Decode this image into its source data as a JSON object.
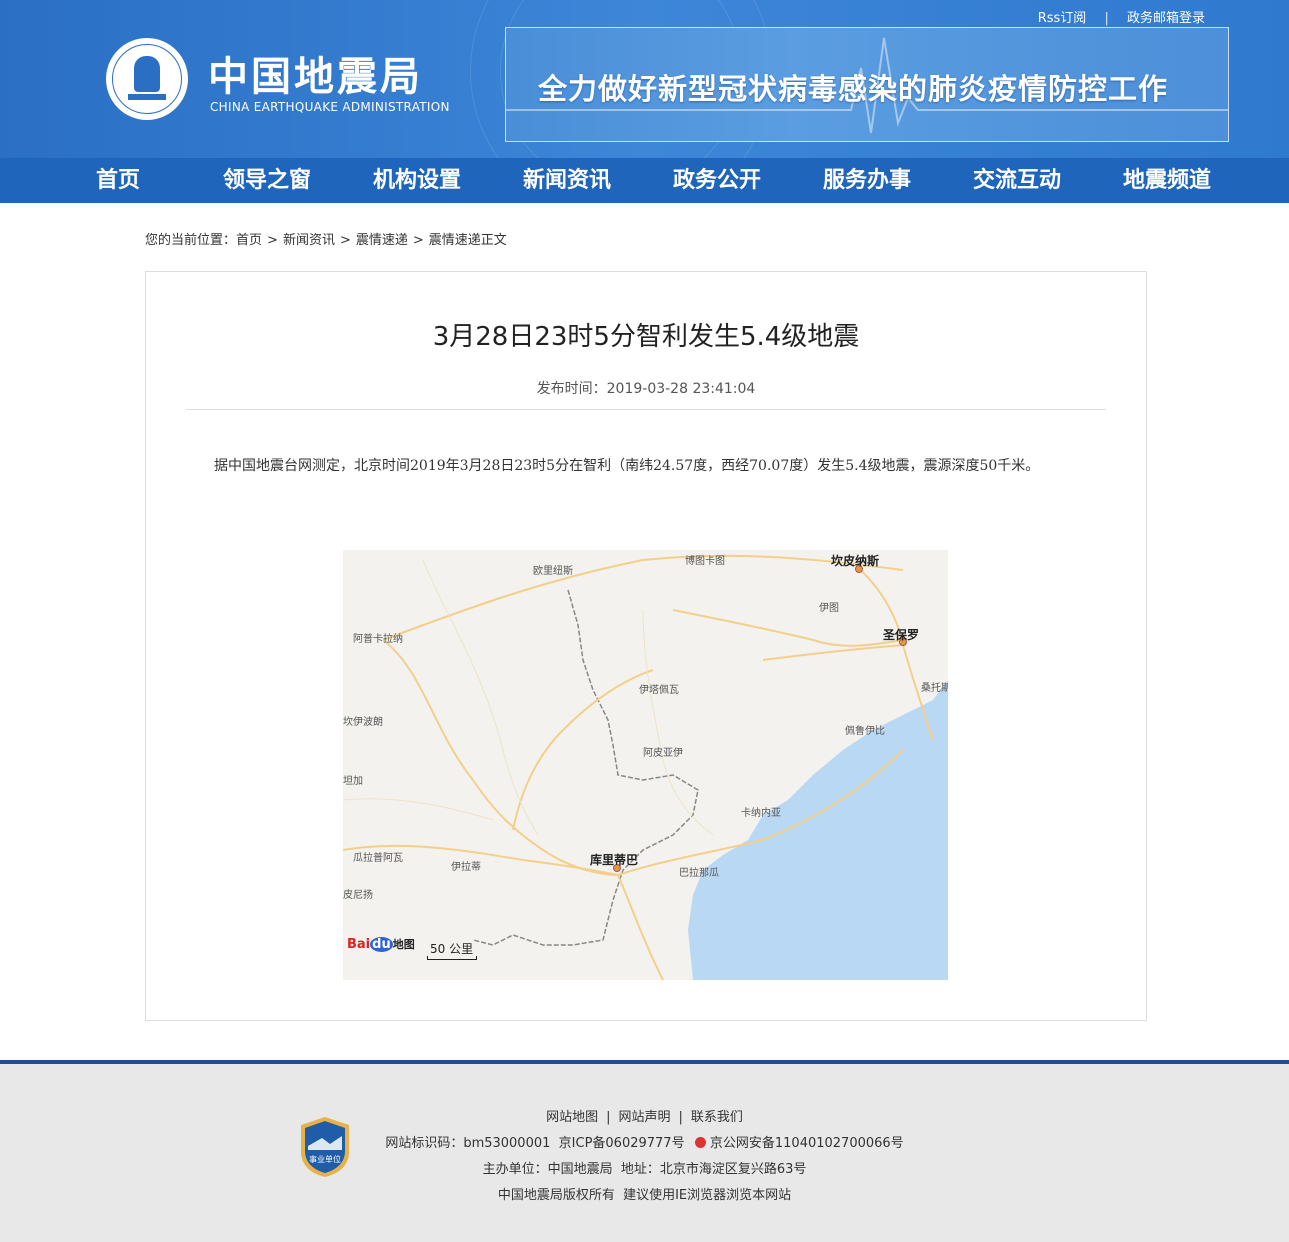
{
  "header": {
    "top_links": [
      "Rss订阅",
      "政务邮箱登录"
    ],
    "logo_cn": "中国地震局",
    "logo_en": "CHINA EARTHQUAKE ADMINISTRATION",
    "banner_text": "全力做好新型冠状病毒感染的肺炎疫情防控工作"
  },
  "nav": [
    "首页",
    "领导之窗",
    "机构设置",
    "新闻资讯",
    "政务公开",
    "服务办事",
    "交流互动",
    "地震频道"
  ],
  "breadcrumb": {
    "prefix": "您的当前位置：",
    "items": [
      "首页",
      "新闻资讯",
      "震情速递",
      "震情速递正文"
    ],
    "separator": ">"
  },
  "article": {
    "title": "3月28日23时5分智利发生5.4级地震",
    "published": "发布时间：2019-03-28 23:41:04",
    "body": "据中国地震台网测定，北京时间2019年3月28日23时5分在智利（南纬24.57度，西经70.07度）发生5.4级地震，震源深度50千米。"
  },
  "map": {
    "cities": [
      "坎皮纳斯",
      "圣保罗",
      "库里蒂巴"
    ],
    "labels": [
      "欧里纽斯",
      "博图卡图",
      "阿普卡拉纳",
      "伊图",
      "伊塔佩瓦",
      "桑托斯",
      "坎伊波朗",
      "佩鲁伊比",
      "阿皮亚伊",
      "坦加",
      "卡纳内亚",
      "瓜拉普阿瓦",
      "伊拉蒂",
      "巴拉那瓜",
      "皮尼扬"
    ],
    "logo": "Bai du 地图",
    "logo_parts": [
      "Bai",
      "du",
      "地图"
    ],
    "scale": "50 公里",
    "water_color": "#b9d8f4",
    "land_color": "#f3f2ef"
  },
  "footer": {
    "links": [
      "网站地图",
      "网站声明",
      "联系我们"
    ],
    "line2": "网站标识码：bm53000001  京ICP备06029777号",
    "line2_police": "京公网安备11040102700066号",
    "line3": "主办单位：中国地震局  地址：北京市海淀区复兴路63号",
    "line4": "中国地震局版权所有  建议使用IE浏览器浏览本网站",
    "badge_text": "事业单位"
  }
}
